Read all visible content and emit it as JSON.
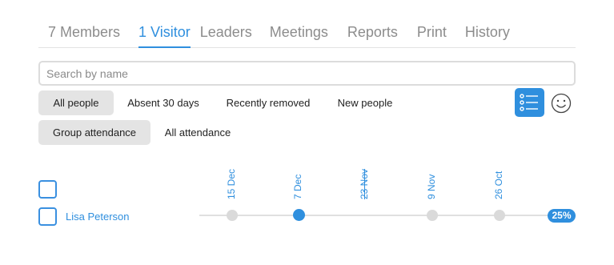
{
  "tabs": [
    {
      "label": "7 Members"
    },
    {
      "label": "1 Visitor"
    },
    {
      "label": "Leaders"
    },
    {
      "label": "Meetings"
    },
    {
      "label": "Reports"
    },
    {
      "label": "Print"
    },
    {
      "label": "History"
    }
  ],
  "active_tab": "1 Visitor",
  "search": {
    "placeholder": "Search by name",
    "value": ""
  },
  "filters": {
    "row1": [
      "All people",
      "Absent 30 days",
      "Recently removed",
      "New people"
    ],
    "row1_selected": "All people",
    "row2": [
      "Group attendance",
      "All attendance"
    ],
    "row2_selected": "Group attendance"
  },
  "view_toggle": {
    "list_icon": "list-view-icon",
    "smiley_icon": "smiley-face-icon",
    "selected": "list"
  },
  "attendance": {
    "dates": [
      {
        "label": "15 Dec",
        "struck": false
      },
      {
        "label": "7 Dec",
        "struck": false
      },
      {
        "label": "23 Nov",
        "struck": true
      },
      {
        "label": "9 Nov",
        "struck": false
      },
      {
        "label": "26 Oct",
        "struck": false
      }
    ],
    "people": [
      {
        "name": "Lisa Peterson",
        "attendance": [
          false,
          true,
          null,
          false,
          false
        ],
        "percent": "25%"
      }
    ]
  },
  "colors": {
    "accent": "#2f8fde",
    "chip_bg": "#e4e4e4",
    "dot_inactive": "#dadada"
  }
}
